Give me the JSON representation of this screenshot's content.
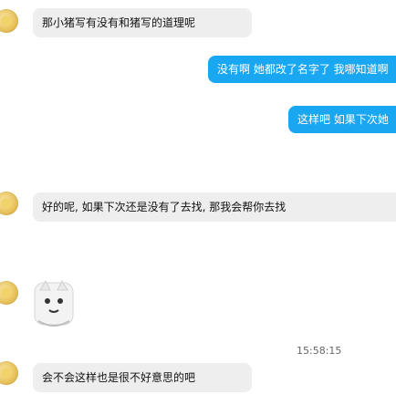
{
  "messages": {
    "m1": {
      "text": "那小猪写有没有和猪写的道理呢"
    },
    "m2": {
      "text": "没有啊 她都改了名字了 我哪知道啊"
    },
    "m3": {
      "text": "这样吧 如果下次她"
    },
    "m4": {
      "text": "好的呢, 如果下次还是没有了去找, 那我会帮你去找"
    },
    "m5": {
      "text": "会不会这样也是很不好意思的吧"
    }
  },
  "timestamp": "15:58:15",
  "colors": {
    "outgoing_bubble": "#1aa7f2",
    "incoming_bubble": "#eeeeee",
    "avatar_gold": "#e9c45f"
  },
  "icons": {
    "avatar": "gold-avatar",
    "sticker": "cat-sticker"
  }
}
